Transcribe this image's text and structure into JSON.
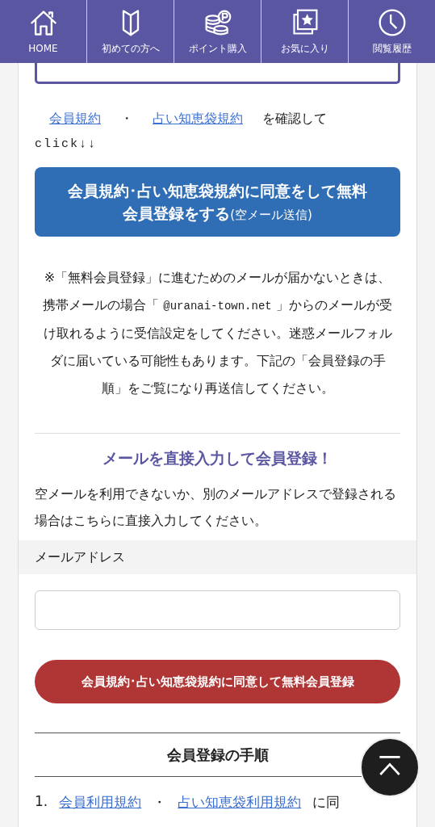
{
  "nav": [
    {
      "label": "HOME"
    },
    {
      "label": "初めての方へ"
    },
    {
      "label": "ポイント購入"
    },
    {
      "label": "お気に入り"
    },
    {
      "label": "閲覧履歴"
    }
  ],
  "terms_line": {
    "link_1": "会員規約",
    "separator": "・",
    "link_2": "占い知恵袋規約",
    "suffix": "を確認して"
  },
  "click_hint": "click↓↓",
  "empty_mail_button": {
    "label": "会員規約･占い知恵袋規約に同意をして無料会員登録をする",
    "note": "(空メール送信)"
  },
  "notice": {
    "before": "※「無料会員登録」に進むためのメールが届かないときは、携帯メールの場合「",
    "address": "@uranai-town.net",
    "after": "」からのメールが受け取れるように受信設定をしてください。迷惑メールフォルダに届いている可能性もあります。下記の「会員登録の手順」をご覧になり再送信してください。"
  },
  "direct_section": {
    "title": "メールを直接入力して会員登録！",
    "description": "空メールを利用できないか、別のメールアドレスで登録される場合はこちらに直接入力してください。",
    "field_label": "メールアドレス",
    "submit_button": "会員規約･占い知恵袋規約に同意して無料会員登録"
  },
  "steps_section": {
    "title": "会員登録の手順",
    "steps": [
      {
        "number": "1.",
        "link_1": "会員利用規約",
        "separator": "・",
        "link_2": "占い知恵袋利用規約",
        "suffix": "に同"
      }
    ]
  }
}
